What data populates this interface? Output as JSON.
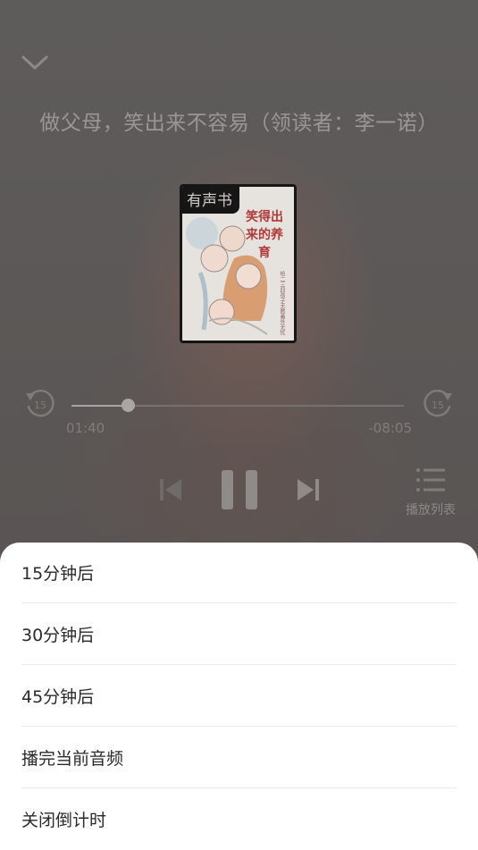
{
  "player": {
    "title": "做父母，笑出来不容易（领读者：李一诺）",
    "cover": {
      "badge": "有声书",
      "book_title": "笑得出来的养育",
      "subtitle": "给二三四孩子无数番外无忧",
      "accent_color": "#b03a3a"
    },
    "skip_back_seconds": "15",
    "skip_forward_seconds": "15",
    "progress": {
      "elapsed": "01:40",
      "remaining": "-08:05",
      "fraction": 0.17
    },
    "state": "playing",
    "playlist_label": "播放列表"
  },
  "timer_sheet": {
    "options": [
      {
        "label": "15分钟后"
      },
      {
        "label": "30分钟后"
      },
      {
        "label": "45分钟后"
      },
      {
        "label": "播完当前音频"
      },
      {
        "label": "关闭倒计时"
      }
    ]
  }
}
